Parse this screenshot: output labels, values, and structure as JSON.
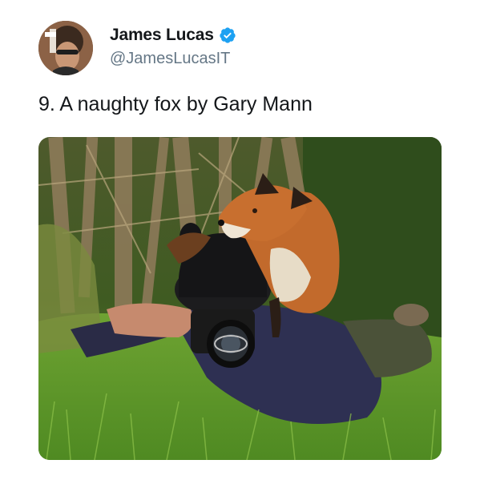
{
  "tweet": {
    "display_name": "James Lucas",
    "handle": "@JamesLucasIT",
    "verified": true,
    "text": "9. A naughty fox by Gary Mann",
    "avatar_icon": "user-avatar",
    "verified_icon": "verified-badge-icon",
    "media_alt": "A fox standing on the back of a photographer lying in the grass"
  },
  "colors": {
    "verified_blue": "#1da1f2",
    "name_text": "#14171a",
    "handle_text": "#657786"
  }
}
